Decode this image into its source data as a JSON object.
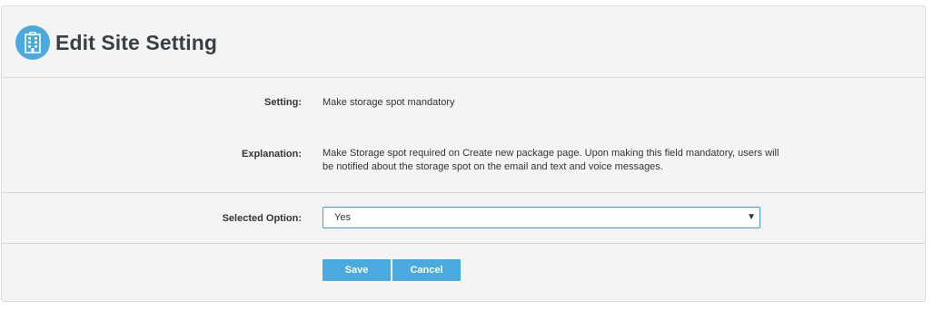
{
  "header": {
    "title": "Edit Site Setting",
    "icon": "building-icon"
  },
  "fields": {
    "setting_label": "Setting:",
    "setting_value": "Make storage spot mandatory",
    "explanation_label": "Explanation:",
    "explanation_lines": [
      "Make Storage spot required on Create new package page. Upon making this field mandatory, users will",
      "be notified about the storage spot on the email and text and voice messages."
    ],
    "selected_option_label": "Selected Option:",
    "selected_option_value": "Yes"
  },
  "actions": {
    "save_label": "Save",
    "cancel_label": "Cancel"
  },
  "colors": {
    "accent": "#4aa9df",
    "panel_bg": "#f4f4f4",
    "select_border": "#4a97d6"
  }
}
